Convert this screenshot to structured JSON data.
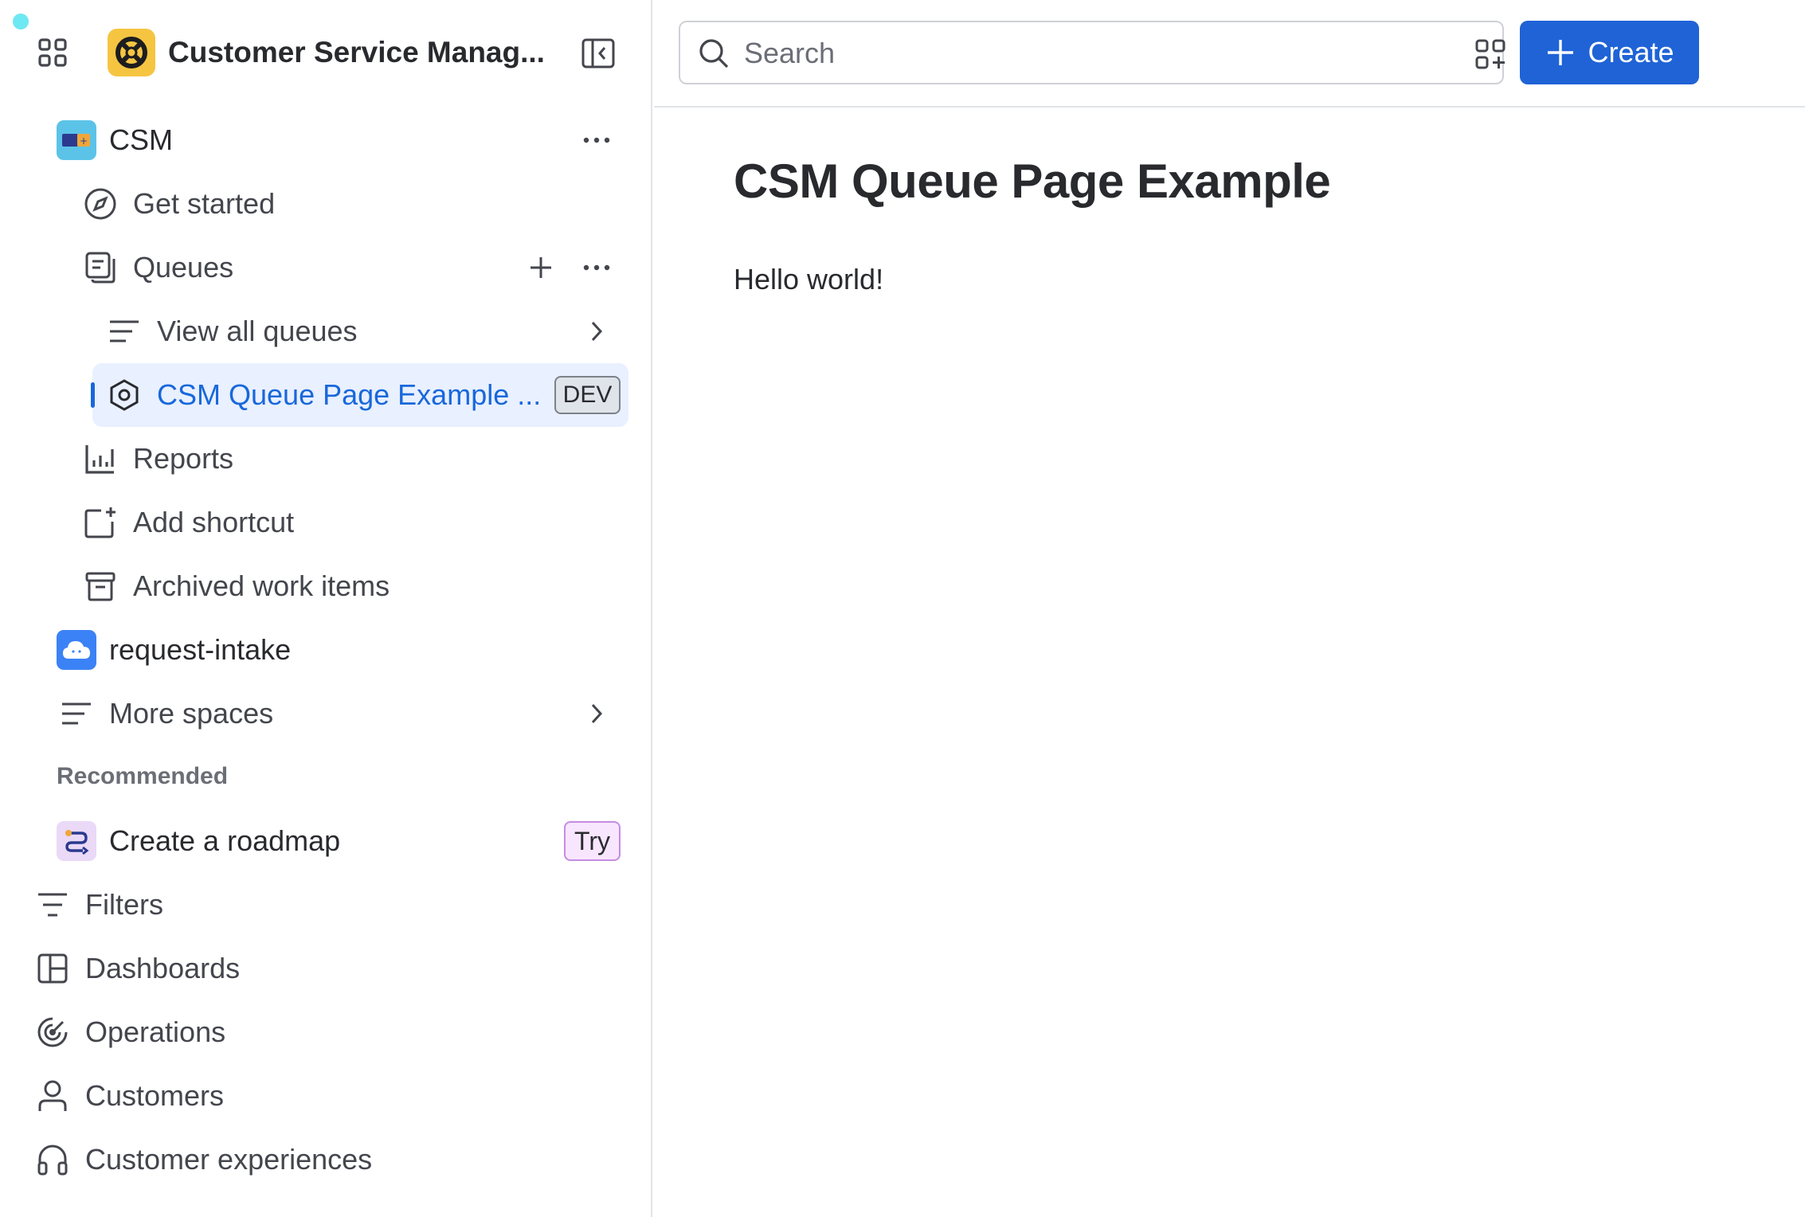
{
  "sidebar": {
    "product_title": "Customer Service Manag...",
    "spaces": {
      "csm": {
        "label": "CSM"
      },
      "request_intake": {
        "label": "request-intake"
      }
    },
    "csm_items": {
      "get_started": "Get started",
      "queues": "Queues",
      "view_all_queues": "View all queues",
      "queue_example": "CSM Queue Page Example ...",
      "queue_example_badge": "DEV",
      "reports": "Reports",
      "add_shortcut": "Add shortcut",
      "archived": "Archived work items"
    },
    "more_spaces": "More spaces",
    "recommended_heading": "Recommended",
    "recommended": {
      "label": "Create a roadmap",
      "badge": "Try"
    },
    "global_items": {
      "filters": "Filters",
      "dashboards": "Dashboards",
      "operations": "Operations",
      "customers": "Customers",
      "customer_experiences": "Customer experiences"
    }
  },
  "topbar": {
    "search_placeholder": "Search",
    "create_label": "Create"
  },
  "main": {
    "title": "CSM Queue Page Example",
    "body": "Hello world!"
  },
  "colors": {
    "accent": "#1f63d6",
    "selected_bg": "#e9f0ff",
    "selected_text": "#1868db",
    "product_logo": "#f5c542"
  }
}
